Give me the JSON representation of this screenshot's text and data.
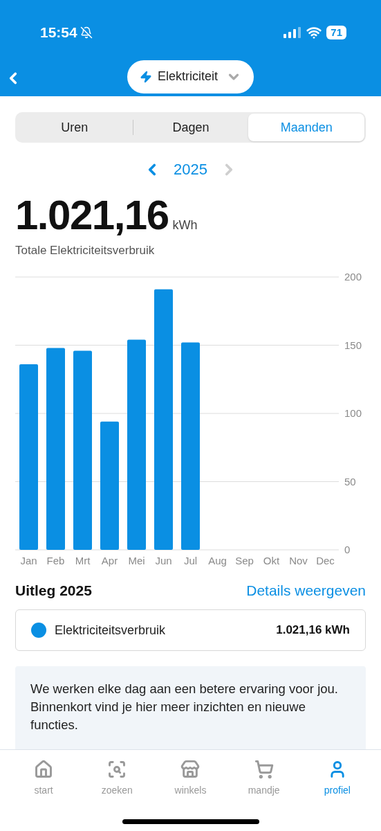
{
  "status_bar": {
    "time": "15:54",
    "battery": "71"
  },
  "header": {
    "selector": "Elektriciteit"
  },
  "tabs": [
    {
      "label": "Uren",
      "selected": false
    },
    {
      "label": "Dagen",
      "selected": false
    },
    {
      "label": "Maanden",
      "selected": true
    }
  ],
  "period": {
    "label": "2025",
    "next_disabled": true
  },
  "total": {
    "value": "1.021,16",
    "unit": "kWh",
    "caption": "Totale Elektriciteitsverbruik"
  },
  "chart_data": {
    "type": "bar",
    "categories": [
      "Jan",
      "Feb",
      "Mrt",
      "Apr",
      "Mei",
      "Jun",
      "Jul",
      "Aug",
      "Sep",
      "Okt",
      "Nov",
      "Dec"
    ],
    "grid": true,
    "series": [
      {
        "color": "#0a8fe3",
        "values": [
          136,
          148,
          146,
          94,
          154,
          191,
          152,
          null,
          null,
          null,
          null,
          null
        ]
      }
    ],
    "ylim": [
      0,
      200
    ],
    "yticks": [
      0,
      50,
      100,
      150,
      200
    ]
  },
  "legend_section": {
    "title": "Uitleg 2025",
    "link": "Details weergeven",
    "items": [
      {
        "label": "Elektriciteitsverbruik",
        "value": "1.021,16 kWh",
        "color": "#0a8fe3"
      }
    ]
  },
  "notice": "We werken elke dag aan een betere ervaring voor jou. Binnenkort vind je hier meer inzichten en nieuwe functies.",
  "bottom_nav": [
    {
      "label": "start",
      "kind": "home",
      "selected": false
    },
    {
      "label": "zoeken",
      "kind": "search",
      "selected": false
    },
    {
      "label": "winkels",
      "kind": "store",
      "selected": false
    },
    {
      "label": "mandje",
      "kind": "cart",
      "selected": false
    },
    {
      "label": "profiel",
      "kind": "profile",
      "selected": true
    }
  ]
}
